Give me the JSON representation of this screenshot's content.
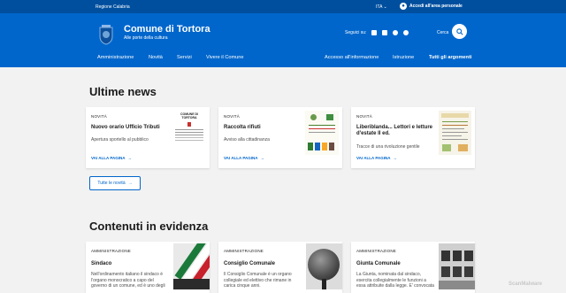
{
  "topbar": {
    "region": "Regione Calabria",
    "lang": "ITA",
    "login": "Accedi all'area personale"
  },
  "header": {
    "title": "Comune di Tortora",
    "subtitle": "Alle porte della cultura",
    "social_label": "Seguici su:",
    "search_label": "Cerca"
  },
  "nav": {
    "left": [
      "Amministrazione",
      "Novità",
      "Servizi",
      "Vivere il Comune"
    ],
    "right": [
      "Accesso all'informazione",
      "Istruzione",
      "Tutti gli argomenti"
    ]
  },
  "news": {
    "heading": "Ultime news",
    "all_label": "Tutte le novità",
    "cards": [
      {
        "kicker": "NOVITÀ",
        "title": "Nuovo orario Ufficio Tributi",
        "desc": "Apertura sportello al pubblico",
        "more": "VAI ALLA PAGINA",
        "thumb_text": "COMUNE DI TORTORA"
      },
      {
        "kicker": "NOVITÀ",
        "title": "Raccolta rifiuti",
        "desc": "Avviso alla cittadinanza",
        "more": "VAI ALLA PAGINA"
      },
      {
        "kicker": "NOVITÀ",
        "title": "Liberiblanda... Lettori e letture d'estate II ed.",
        "desc": "Tracce di una rivoluzione gentile",
        "more": "VAI ALLA PAGINA"
      }
    ]
  },
  "featured": {
    "heading": "Contenuti in evidenza",
    "cards": [
      {
        "kicker": "AMMINISTRAZIONE",
        "title": "Sindaco",
        "desc": "Nell'ordinamento italiano il sindaco è l'organo monocratico a capo del governo di un comune, ed è uno degli"
      },
      {
        "kicker": "AMMINISTRAZIONE",
        "title": "Consiglio Comunale",
        "desc": "Il Consiglio Comunale è un organo collegiale ed elettivo che rimane in carica cinque anni."
      },
      {
        "kicker": "AMMINISTRAZIONE",
        "title": "Giunta Comunale",
        "desc": "La Giunta, nominata dal sindaco, esercita collegialmente le funzioni a essa attribuite dalla legge. E' convocata"
      }
    ]
  },
  "watermark": "ScanMalware",
  "colors": {
    "primary": "#0066cc",
    "topbar": "#004f9f"
  }
}
